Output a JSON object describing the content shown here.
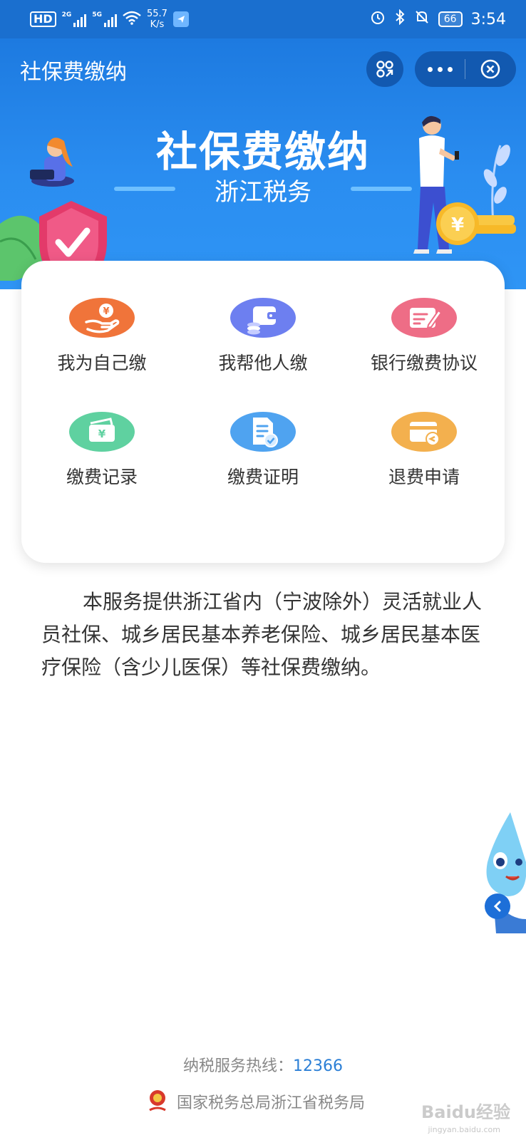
{
  "status_bar": {
    "hd": "HD",
    "sig1_tag": "2G",
    "sig2_tag": "5G",
    "speed": "55.7",
    "speed_unit": "K/s",
    "battery": "66",
    "time": "3:54"
  },
  "nav": {
    "title": "社保费缴纳"
  },
  "hero": {
    "title": "社保费缴纳",
    "subtitle": "浙江税务"
  },
  "menu": [
    {
      "label": "我为自己缴",
      "icon": "hand-yen-icon",
      "color": "#f0743a"
    },
    {
      "label": "我帮他人缴",
      "icon": "wallet-icon",
      "color": "#6d7ff0"
    },
    {
      "label": "银行缴费协议",
      "icon": "edit-doc-icon",
      "color": "#ee6d86"
    },
    {
      "label": "缴费记录",
      "icon": "yen-card-icon",
      "color": "#5fd1a0"
    },
    {
      "label": "缴费证明",
      "icon": "doc-check-icon",
      "color": "#4fa3f0"
    },
    {
      "label": "退费申请",
      "icon": "card-refund-icon",
      "color": "#f3b04e"
    }
  ],
  "description": "本服务提供浙江省内（宁波除外）灵活就业人员社保、城乡居民基本养老保险、城乡居民基本医疗保险（含少儿医保）等社保费缴纳。",
  "footer": {
    "hotline_label": "纳税服务热线：",
    "hotline_number": "12366",
    "org": "国家税务总局浙江省税务局"
  },
  "watermark": {
    "text": "Baidu经验",
    "url": "jingyan.baidu.com"
  }
}
